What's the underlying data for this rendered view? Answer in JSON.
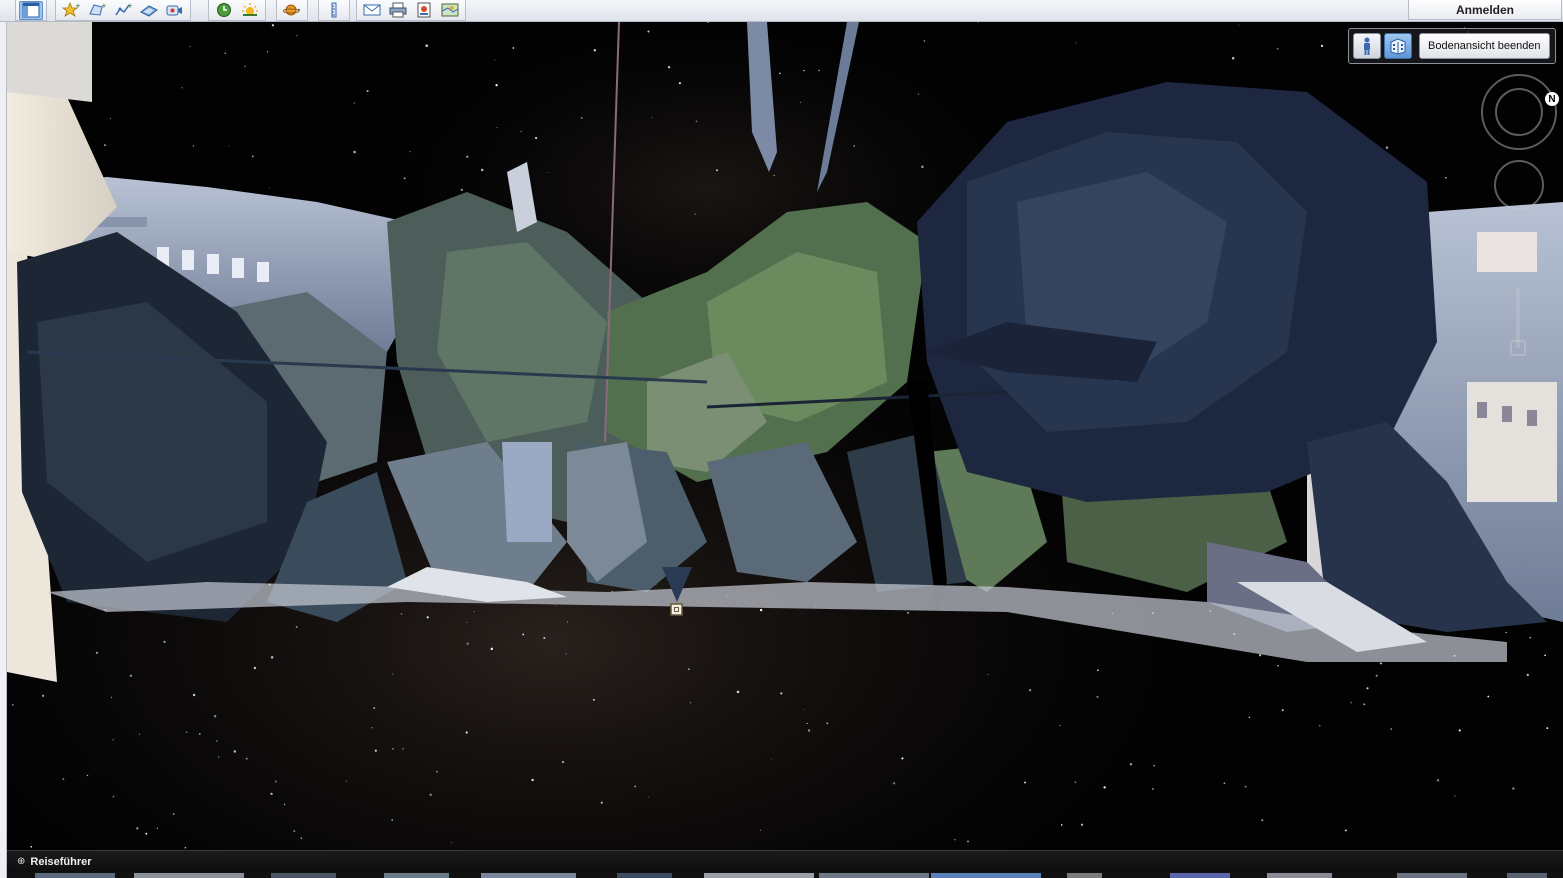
{
  "toolbar": {
    "groups": [
      {
        "items": [
          {
            "icon": "sidebar-toggle-icon",
            "active": true
          }
        ]
      },
      {
        "items": [
          {
            "icon": "add-placemark-icon"
          },
          {
            "icon": "add-polygon-icon"
          },
          {
            "icon": "add-path-icon"
          },
          {
            "icon": "add-image-overlay-icon"
          },
          {
            "icon": "record-tour-icon"
          }
        ]
      },
      {
        "items": [
          {
            "icon": "historical-imagery-icon"
          },
          {
            "icon": "sunlight-icon"
          }
        ]
      },
      {
        "items": [
          {
            "icon": "planets-icon"
          }
        ]
      },
      {
        "items": [
          {
            "icon": "ruler-icon"
          }
        ]
      },
      {
        "items": [
          {
            "icon": "email-icon"
          },
          {
            "icon": "print-icon"
          },
          {
            "icon": "save-image-icon"
          },
          {
            "icon": "view-in-maps-icon"
          }
        ]
      }
    ],
    "signin_label": "Anmelden"
  },
  "ground_view": {
    "exit_label": "Bodenansicht beenden",
    "person_icon": "person-icon",
    "building_icon": "3d-building-icon"
  },
  "navigation": {
    "north_label": "N"
  },
  "tour_guide": {
    "label": "Reiseführer"
  },
  "colors": {
    "sky": "#000000",
    "toolbar": "#e6e9ef",
    "active_blue": "#5d96d6"
  }
}
